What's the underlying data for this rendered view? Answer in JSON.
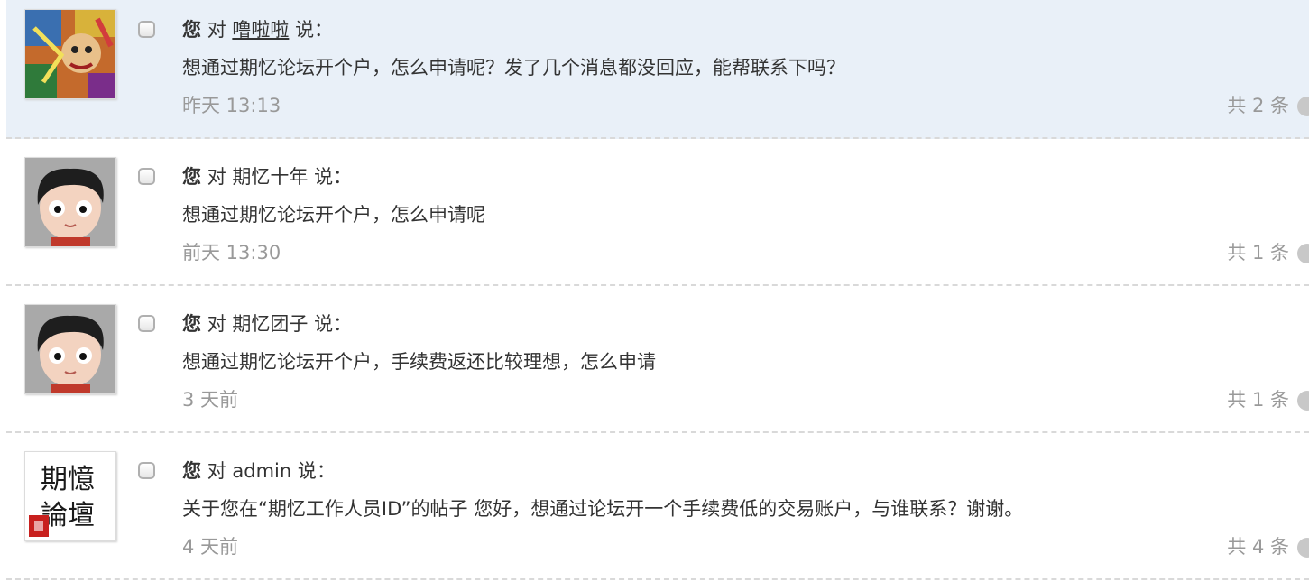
{
  "messages": [
    {
      "you": "您",
      "to": "对",
      "user": "噜啦啦",
      "says": "说：",
      "text": "想通过期忆论坛开个户，怎么申请呢？发了几个消息都没回应，能帮联系下吗？",
      "time": "昨天 13:13",
      "count": "共 2 条",
      "avatar": "colorful-art-avatar",
      "highlight": true
    },
    {
      "you": "您",
      "to": "对",
      "user": "期忆十年",
      "says": "说：",
      "text": "想通过期忆论坛开个户，怎么申请呢",
      "time": "前天 13:30",
      "count": "共 1 条",
      "avatar": "cartoon-boy-avatar",
      "highlight": false
    },
    {
      "you": "您",
      "to": "对",
      "user": "期忆团子",
      "says": "说：",
      "text": "想通过期忆论坛开个户，手续费返还比较理想，怎么申请",
      "time": "3 天前",
      "count": "共 1 条",
      "avatar": "cartoon-boy-avatar",
      "highlight": false
    },
    {
      "you": "您",
      "to": "对",
      "user": "admin",
      "says": "说：",
      "text": "关于您在“期忆工作人员ID”的帖子 您好，想通过论坛开一个手续费低的交易账户，与谁联系？谢谢。",
      "time": "4 天前",
      "count": "共 4 条",
      "avatar": "calligraphy-logo-avatar",
      "logo_text": "期憶論壇",
      "highlight": false
    }
  ],
  "colors": {
    "highlight_bg": "#e9f0f8",
    "muted_text": "#999999",
    "main_text": "#333333",
    "divider": "#d9d9d9"
  }
}
